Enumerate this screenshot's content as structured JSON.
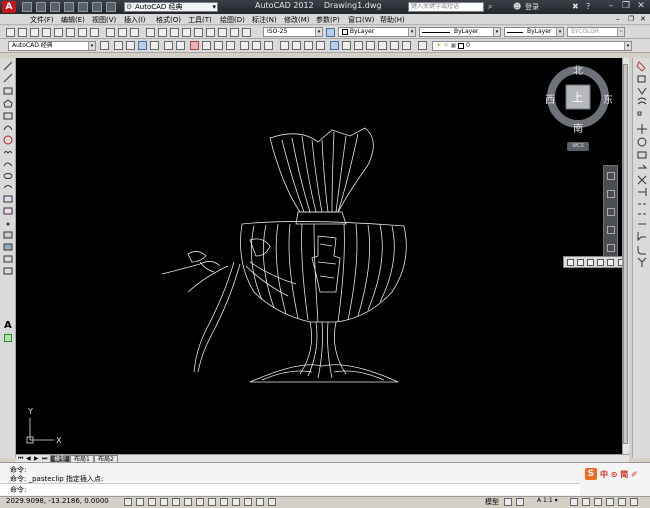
{
  "titlebar": {
    "logo_letter": "A",
    "workspace": "AutoCAD 经典",
    "window_title": "AutoCAD 2012    Drawing1.dwg",
    "search_placeholder": "键入关键字或短语",
    "login": "登录",
    "minimize": "–",
    "restore": "❐",
    "close": "✕"
  },
  "menu": [
    "文件(F)",
    "编辑(E)",
    "视图(V)",
    "插入(I)",
    "格式(O)",
    "工具(T)",
    "绘图(D)",
    "标注(N)",
    "修改(M)",
    "参数(P)",
    "窗口(W)",
    "帮助(H)"
  ],
  "toolbar2": {
    "dimstyle": "ISO-25",
    "layer_color": "ByLayer",
    "linetype": "ByLayer",
    "lineweight": "ByLayer",
    "plotstyle": "BYCOLOR"
  },
  "toolbar3": {
    "workspace": "AutoCAD 经典",
    "layer": "0"
  },
  "viewcube": {
    "north": "北",
    "south": "南",
    "west": "西",
    "east": "东",
    "top": "上",
    "wcs": "WCS"
  },
  "ucs": {
    "y": "Y",
    "x": "X"
  },
  "layout_tabs": [
    "模型",
    "布局1",
    "布局2"
  ],
  "command": {
    "line1": "命令:",
    "line2": "命令: _pasteclip 指定插入点:",
    "prompt": "命令:"
  },
  "brand": {
    "icon": "S",
    "text": "中 ⊙ 简 ✐"
  },
  "status": {
    "coords": "2029.9098, -13.2186, 0.0000",
    "model": "模型",
    "scale": "A 1:1 ▾",
    "accent": "#c8161d"
  }
}
